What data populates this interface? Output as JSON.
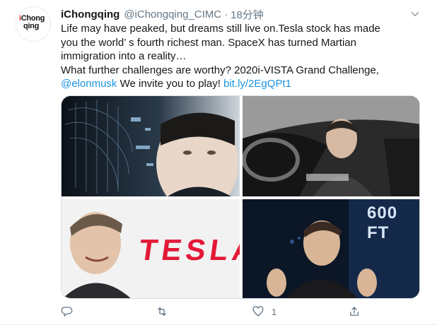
{
  "tweet": {
    "avatar_logo_line1": "Chong",
    "avatar_logo_line2": "qing",
    "avatar_logo_prefix": "i",
    "display_name": "iChongqing",
    "handle": "@iChongqing_CIMC",
    "separator": "·",
    "timestamp": "18分钟",
    "text_lines": [
      "Life may have peaked, but dreams still live on.Tesla stock has made",
      "you the world’ s fourth richest man. SpaceX has turned Martian",
      "immigration into a reality…",
      "What further challenges are worthy? 2020i-VISTA Grand Challenge,"
    ],
    "mention": "@elonmusk",
    "text_after_mention": " We invite you to play! ",
    "link": "bit.ly/2EgQPt1",
    "media": {
      "tesla_sign": "TESLA",
      "stage_sign": "600 FT"
    },
    "actions": {
      "reply_icon": "reply-icon",
      "retweet_icon": "retweet-icon",
      "like_icon": "heart-icon",
      "like_count": "1",
      "share_icon": "share-icon"
    }
  },
  "colors": {
    "link": "#1b95e0",
    "muted": "#657786",
    "brand_red": "#e1232a"
  }
}
